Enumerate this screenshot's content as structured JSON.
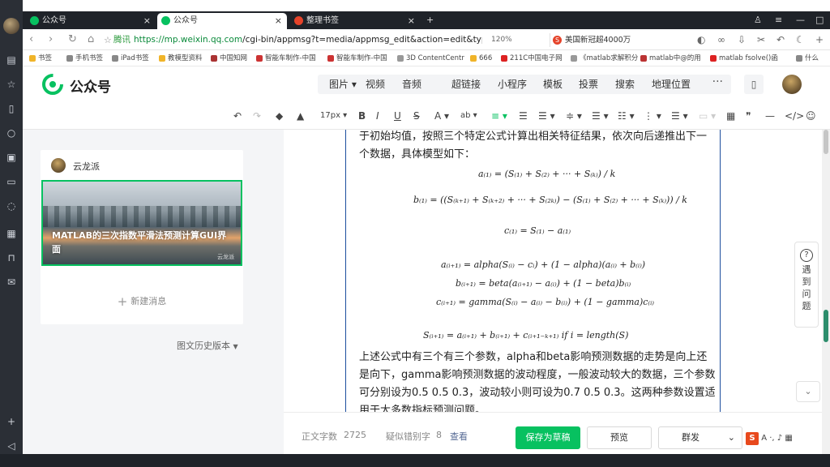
{
  "browser": {
    "tabs": [
      {
        "label": "公众号",
        "active": false
      },
      {
        "label": "公众号",
        "active": true
      },
      {
        "label": "整理书签",
        "active": false
      }
    ],
    "new_tab": "+",
    "url_secure": "腾讯",
    "url_host": "https://mp.weixin.qq.com",
    "url_path": "/cgi-bin/appmsg?t=media/appmsg_edit&action=edit&type=",
    "zoom": "120%",
    "search_box": "美国新冠超4000万",
    "bookmarks": [
      "书签",
      "手机书签",
      "iPad书签",
      "教模型资料",
      "中国知网",
      "智能车制作-中国",
      "智能车制作-中国",
      "3D ContentCentr",
      "666",
      "211C中国电子网",
      "《matlab求解积分",
      "matlab中@的用",
      "matlab fsolve()函",
      "什么"
    ]
  },
  "header": {
    "logo_text": "公众号",
    "menu": [
      "图片",
      "视频",
      "音频",
      "超链接",
      "小程序",
      "模板",
      "投票",
      "搜索",
      "地理位置"
    ],
    "more": "···"
  },
  "toolbar": {
    "font_size": "17px"
  },
  "left": {
    "author": "云龙派",
    "cover_title": "MATLAB的三次指数平滑法预测计算GUI界面",
    "cover_watermark": "云龙派",
    "new_message": "新建消息",
    "history": "图文历史版本"
  },
  "editor": {
    "para1": "于初始均值，按照三个特定公式计算出相关特征结果，依次向后递推出下一个数据，具体模型如下：",
    "formulas": {
      "f1": "a₍₁₎ = (S₍₁₎ + S₍₂₎ + ··· + S₍ₖ₎) / k",
      "f2": "b₍₁₎ = ((S₍ₖ₊₁₎ + S₍ₖ₊₂₎ + ··· + S₍₂ₖ₎) − (S₍₁₎ + S₍₂₎ + ··· + S₍ₖ₎)) / k",
      "f3": "c₍₁₎ = S₍₁₎ − a₍₁₎",
      "f4": "a₍ᵢ₊₁₎ = alpha(S₍ᵢ₎ − cᵢ) + (1 − alpha)(a₍ᵢ₎ + b₍ᵢ₎)",
      "f5": "b₍ᵢ₊₁₎ = beta(a₍ᵢ₊₁₎ − a₍ᵢ₎) + (1 − beta)b₍ᵢ₎",
      "f6": "c₍ᵢ₊₁₎ = gamma(S₍ᵢ₎ − a₍ᵢ₎ − b₍ᵢ₎) + (1 − gamma)c₍ᵢ₎",
      "f7": "S₍ᵢ₊₁₎ = a₍ᵢ₊₁₎ + b₍ᵢ₊₁₎ + c₍ᵢ₊₁₋ₖ₊₁₎      if  i = length(S)"
    },
    "para2": "上述公式中有三个有三个参数，alpha和beta影响预测数据的走势是向上还是向下，gamma影响预测数据的波动程度，一般波动较大的数据，三个参数可分别设为0.5 0.5 0.3，波动较小则可设为0.7 0.5 0.3。这两种参数设置适用于大多数指标预测问题。"
  },
  "float": {
    "help": "遇到问题"
  },
  "bottom": {
    "word_count_label": "正文字数",
    "word_count": "2725",
    "typo_label": "疑似错别字",
    "typo_count": "8",
    "check": "查看",
    "save": "保存为草稿",
    "preview": "预览",
    "mass_send": "群发"
  },
  "ime": {
    "letter": "S",
    "mode": "A"
  },
  "colors": {
    "accent": "#07c160",
    "frame": "#1d4e9e",
    "link": "#576b95"
  }
}
